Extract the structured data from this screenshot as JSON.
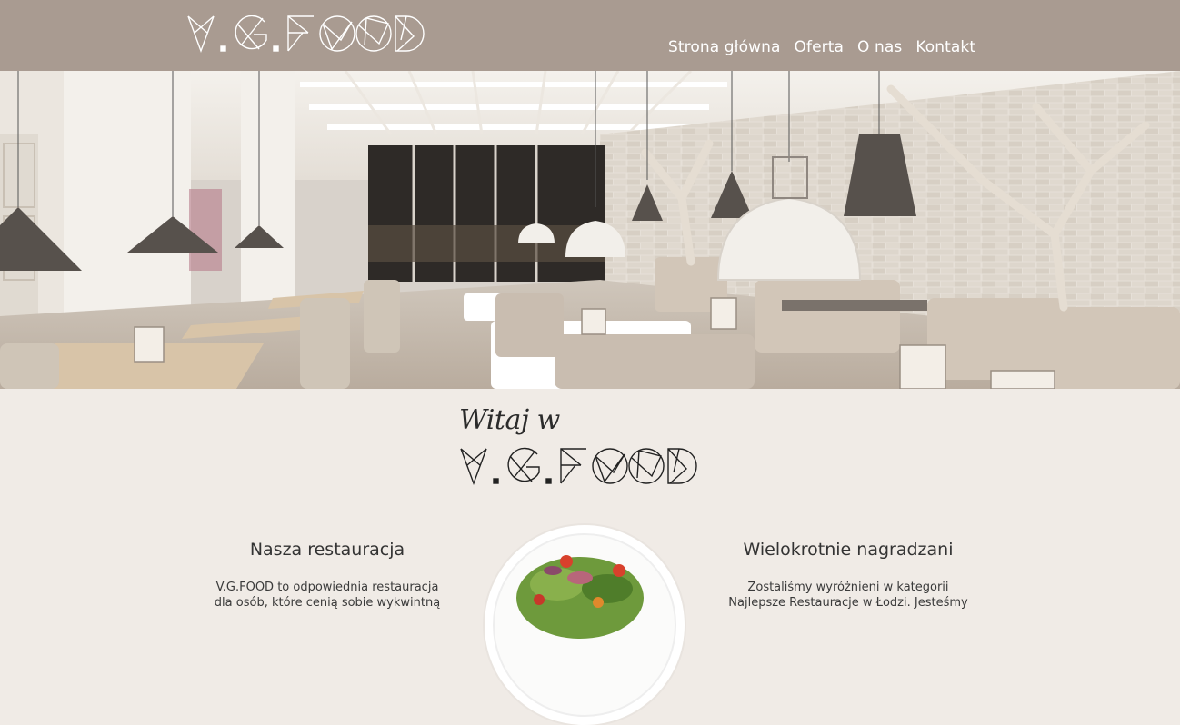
{
  "header": {
    "logo_text": "V.G.FOOD",
    "nav": [
      {
        "label": "Strona główna"
      },
      {
        "label": "Oferta"
      },
      {
        "label": "O nas"
      },
      {
        "label": "Kontakt"
      }
    ]
  },
  "hero": {
    "slides_total": 3,
    "active_slide": 2
  },
  "intro": {
    "welcome": "Witaj w",
    "logo_text": "V.G.FOOD"
  },
  "columns": {
    "left": {
      "title": "Nasza restauracja",
      "line1": "V.G.FOOD to odpowiednia restauracja",
      "line2": "dla osób, które cenią sobie wykwintną"
    },
    "right": {
      "title": "Wielokrotnie nagradzani",
      "line1": "Zostaliśmy wyróżnieni w kategorii",
      "line2": "Najlepsze Restauracje w Łodzi. Jesteśmy"
    }
  },
  "colors": {
    "header_bg": "#a99b91",
    "page_bg": "#f0ebe6",
    "text_dark": "#333333"
  }
}
